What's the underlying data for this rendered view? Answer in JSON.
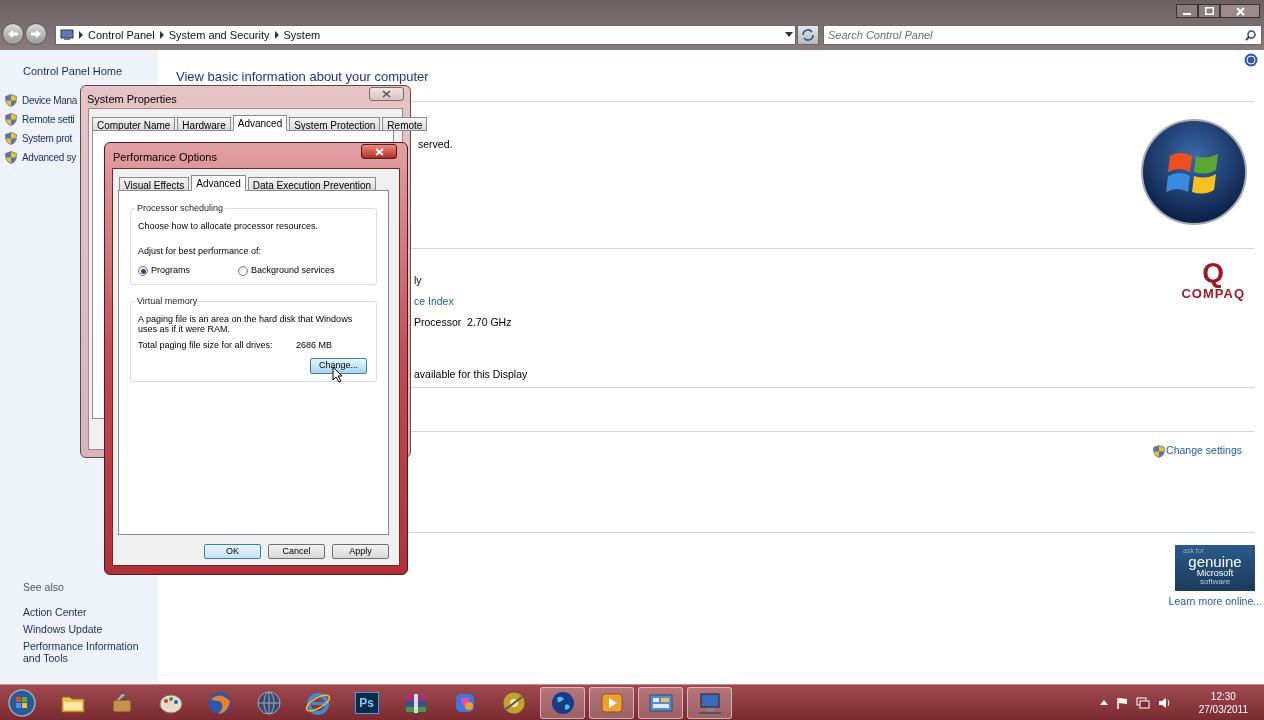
{
  "explorer": {
    "breadcrumb": [
      "Control Panel",
      "System and Security",
      "System"
    ],
    "search": {
      "placeholder": "Search Control Panel"
    }
  },
  "sidebar": {
    "home": "Control Panel Home",
    "tasks": [
      "Device Mana",
      "Remote setti",
      "System prot",
      "Advanced sy"
    ],
    "see_also_title": "See also",
    "see_also": [
      "Action Center",
      "Windows Update",
      "Performance Information and Tools"
    ]
  },
  "main": {
    "heading": "View basic information about your computer",
    "info_upper": [
      {
        "text": "served."
      }
    ],
    "info_lower": [
      {
        "text": "ly",
        "kind": "text"
      },
      {
        "text": "ce Index",
        "kind": "link"
      },
      {
        "text": "Processor  2.70 GHz",
        "kind": "text"
      },
      {
        "text": "available for this Display",
        "kind": "text"
      }
    ],
    "compaq": {
      "mark": "Q",
      "wordmark": "COMPAQ"
    },
    "change_settings": "Change settings",
    "badge": {
      "top": "ask for",
      "main": "genuine",
      "brand": "Microsoft",
      "sub": "software"
    },
    "learn_more": "Learn more online..."
  },
  "system_properties": {
    "title": "System Properties",
    "tabs": [
      {
        "label": "Computer Name",
        "selected": false
      },
      {
        "label": "Hardware",
        "selected": false
      },
      {
        "label": "Advanced",
        "selected": true
      },
      {
        "label": "System Protection",
        "selected": false
      },
      {
        "label": "Remote",
        "selected": false
      }
    ]
  },
  "performance_options": {
    "title": "Performance Options",
    "tabs": [
      {
        "label": "Visual Effects",
        "selected": false
      },
      {
        "label": "Advanced",
        "selected": true
      },
      {
        "label": "Data Execution Prevention",
        "selected": false
      }
    ],
    "processor_scheduling": {
      "title": "Processor scheduling",
      "description": "Choose how to allocate processor resources.",
      "adjust_label": "Adjust for best performance of:",
      "options": [
        {
          "label": "Programs",
          "selected": true
        },
        {
          "label": "Background services",
          "selected": false
        }
      ]
    },
    "virtual_memory": {
      "title": "Virtual memory",
      "description": "A paging file is an area on the hard disk that Windows uses as if it were RAM.",
      "total_label": "Total paging file size for all drives:",
      "total_value": "2686 MB",
      "change_button": "Change..."
    },
    "buttons": [
      {
        "label": "OK",
        "default": true
      },
      {
        "label": "Cancel",
        "default": false
      },
      {
        "label": "Apply",
        "default": false
      }
    ]
  },
  "taskbar": {
    "apps": [
      {
        "kind": "folder",
        "active": false
      },
      {
        "kind": "tools",
        "active": false
      },
      {
        "kind": "palette",
        "active": false
      },
      {
        "kind": "fox",
        "active": false
      },
      {
        "kind": "globe",
        "active": false
      },
      {
        "kind": "ie",
        "active": false
      },
      {
        "kind": "ps",
        "label": "Ps",
        "active": false
      },
      {
        "kind": "books",
        "active": false
      },
      {
        "kind": "gem",
        "active": false
      },
      {
        "kind": "disc",
        "active": false
      },
      {
        "kind": "earth",
        "active": true
      },
      {
        "kind": "media",
        "active": true
      },
      {
        "kind": "panel",
        "active": true
      },
      {
        "kind": "computer",
        "active": true
      }
    ],
    "clock": {
      "time": "12:30",
      "date": "27/03/2011"
    }
  }
}
